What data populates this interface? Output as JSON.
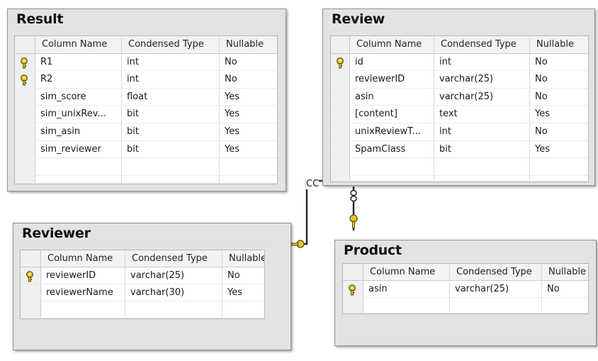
{
  "columns": {
    "name": "Column Name",
    "type": "Condensed Type",
    "nullable": "Nullable"
  },
  "connector_label": "CC",
  "tables": {
    "result": {
      "title": "Result",
      "rows": [
        {
          "key": true,
          "name": "R1",
          "type": "int",
          "nullable": "No"
        },
        {
          "key": true,
          "name": "R2",
          "type": "int",
          "nullable": "No"
        },
        {
          "key": false,
          "name": "sim_score",
          "type": "float",
          "nullable": "Yes"
        },
        {
          "key": false,
          "name": "sim_unixRev...",
          "type": "bit",
          "nullable": "Yes"
        },
        {
          "key": false,
          "name": "sim_asin",
          "type": "bit",
          "nullable": "Yes"
        },
        {
          "key": false,
          "name": "sim_reviewer",
          "type": "bit",
          "nullable": "Yes"
        }
      ]
    },
    "review": {
      "title": "Review",
      "rows": [
        {
          "key": true,
          "name": "id",
          "type": "int",
          "nullable": "No"
        },
        {
          "key": false,
          "name": "reviewerID",
          "type": "varchar(25)",
          "nullable": "No"
        },
        {
          "key": false,
          "name": "asin",
          "type": "varchar(25)",
          "nullable": "No"
        },
        {
          "key": false,
          "name": "[content]",
          "type": "text",
          "nullable": "Yes"
        },
        {
          "key": false,
          "name": "unixReviewT...",
          "type": "int",
          "nullable": "No"
        },
        {
          "key": false,
          "name": "SpamClass",
          "type": "bit",
          "nullable": "Yes"
        }
      ]
    },
    "reviewer": {
      "title": "Reviewer",
      "rows": [
        {
          "key": true,
          "name": "reviewerID",
          "type": "varchar(25)",
          "nullable": "No"
        },
        {
          "key": false,
          "name": "reviewerName",
          "type": "varchar(30)",
          "nullable": "Yes"
        }
      ]
    },
    "product": {
      "title": "Product",
      "rows": [
        {
          "key": true,
          "name": "asin",
          "type": "varchar(25)",
          "nullable": "No"
        }
      ]
    }
  },
  "colors": {
    "panel": "#e3e3e3",
    "key_gold": "#e6c62a",
    "connector": "#333333"
  },
  "icons": {
    "primary_key": "key-icon",
    "infinity_end": "many-icon"
  }
}
